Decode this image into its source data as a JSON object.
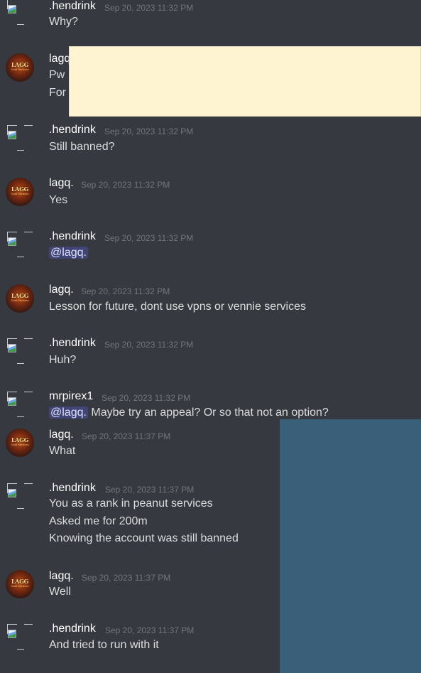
{
  "messages": [
    {
      "author": ".hendrink",
      "avatar": "default-avatar",
      "time": "Sep 20, 2023 11:32 PM",
      "lines": [
        "Why?"
      ]
    },
    {
      "author": "lagq.",
      "avatar": "lagq-avatar",
      "time": "",
      "lines": [
        "Pw",
        "For"
      ]
    },
    {
      "author": ".hendrink",
      "avatar": "default-avatar",
      "time": "Sep 20, 2023 11:32 PM",
      "lines": [
        "Still banned?"
      ]
    },
    {
      "author": "lagq.",
      "avatar": "lagq-avatar",
      "time": "Sep 20, 2023 11:32 PM",
      "lines": [
        "Yes"
      ]
    },
    {
      "author": ".hendrink",
      "avatar": "default-avatar",
      "time": "Sep 20, 2023 11:32 PM",
      "mention": "@lagq.",
      "lines": [
        ""
      ]
    },
    {
      "author": "lagq.",
      "avatar": "lagq-avatar",
      "time": "Sep 20, 2023 11:32 PM",
      "lines": [
        "Lesson for future, dont use vpns or vennie services"
      ]
    },
    {
      "author": ".hendrink",
      "avatar": "default-avatar",
      "time": "Sep 20, 2023 11:32 PM",
      "lines": [
        "Huh?"
      ]
    },
    {
      "author": "mrpirex1",
      "avatar": "default-avatar",
      "time": "Sep 20, 2023 11:32 PM",
      "mention": "@lagq.",
      "lines": [
        "Maybe try an appeal? Or so that not an option?"
      ]
    },
    {
      "author": "lagq.",
      "avatar": "lagq-avatar",
      "time": "Sep 20, 2023 11:37 PM",
      "lines": [
        "What"
      ]
    },
    {
      "author": ".hendrink",
      "avatar": "default-avatar",
      "time": "Sep 20, 2023 11:37 PM",
      "lines": [
        "You as a rank in peanut services",
        "Asked me for 200m",
        "Knowing the account was still banned"
      ]
    },
    {
      "author": "lagq.",
      "avatar": "lagq-avatar",
      "time": "Sep 20, 2023 11:37 PM",
      "lines": [
        "Well"
      ]
    },
    {
      "author": ".hendrink",
      "avatar": "default-avatar",
      "time": "Sep 20, 2023 11:37 PM",
      "lines": [
        "And tried to run with it"
      ]
    }
  ],
  "lagq_avatar_text": {
    "line1": "LAGG",
    "line2": "Gold Services"
  }
}
